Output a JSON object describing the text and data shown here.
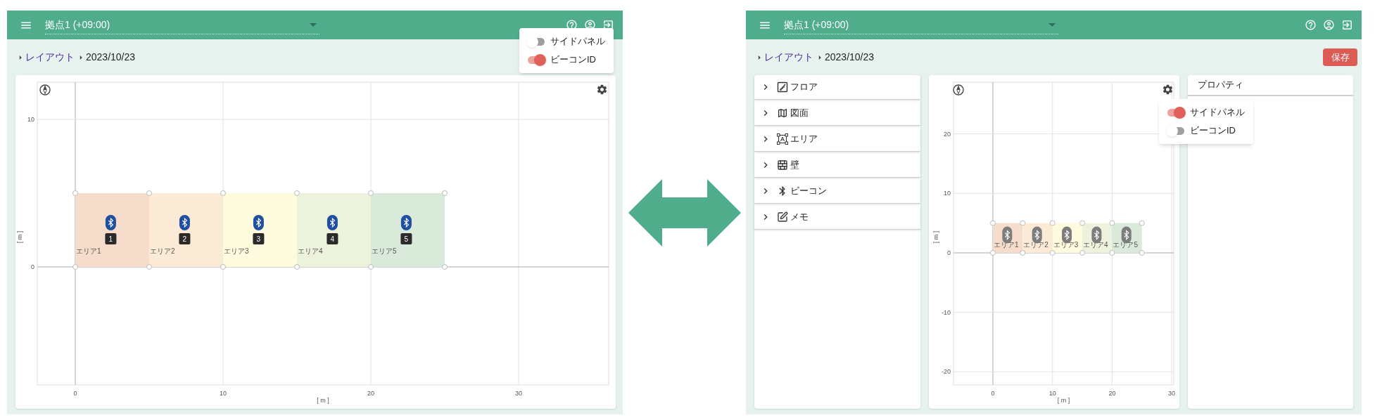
{
  "screens": [
    {
      "header": {
        "location": "拠点1 (+09:00)"
      },
      "breadcrumb": [
        {
          "label": "レイアウト",
          "link": true
        },
        {
          "label": "2023/10/23",
          "link": false
        }
      ],
      "settings_menu": [
        {
          "label": "サイドパネル",
          "on": false
        },
        {
          "label": "ビーコンID",
          "on": true
        }
      ],
      "canvas": {
        "x_ticks": [
          "0",
          "10",
          "20",
          "30"
        ],
        "y_ticks": [
          "10",
          "0"
        ],
        "x_axis_label": "[ m ]",
        "y_axis_label": "[ m ]",
        "areas": [
          {
            "name": "エリア1",
            "color": "#f6dccb",
            "beacon_id": "1"
          },
          {
            "name": "エリア2",
            "color": "#fbead5",
            "beacon_id": "2"
          },
          {
            "name": "エリア3",
            "color": "#fefadd",
            "beacon_id": "3"
          },
          {
            "name": "エリア4",
            "color": "#ecf2dc",
            "beacon_id": "4"
          },
          {
            "name": "エリア5",
            "color": "#d9e9da",
            "beacon_id": "5"
          }
        ]
      }
    },
    {
      "header": {
        "location": "拠点1 (+09:00)"
      },
      "breadcrumb": [
        {
          "label": "レイアウト",
          "link": true
        },
        {
          "label": "2023/10/23",
          "link": false
        }
      ],
      "save_button": {
        "label": "保存"
      },
      "settings_menu": [
        {
          "label": "サイドパネル",
          "on": true
        },
        {
          "label": "ビーコンID",
          "on": false
        }
      ],
      "side_panel": {
        "items": [
          {
            "kind": "floor",
            "label": "フロア",
            "expanded": false
          },
          {
            "kind": "drawing",
            "label": "図面",
            "expanded": false
          },
          {
            "kind": "area",
            "label": "エリア",
            "expanded": false
          },
          {
            "kind": "wall",
            "label": "壁",
            "expanded": false
          },
          {
            "kind": "beacon",
            "label": "ビーコン",
            "expanded": false
          },
          {
            "kind": "memo",
            "label": "メモ",
            "expanded": false
          }
        ]
      },
      "property_panel": {
        "title": "プロパティ"
      },
      "canvas": {
        "x_ticks": [
          "0",
          "10",
          "20",
          "30"
        ],
        "y_ticks": [
          "20",
          "10",
          "0",
          "-10",
          "-20"
        ],
        "x_axis_label": "[ m ]",
        "y_axis_label": "[ m ]",
        "areas": [
          {
            "name": "エリア1",
            "color": "#f6dccb"
          },
          {
            "name": "エリア2",
            "color": "#fbead5"
          },
          {
            "name": "エリア3",
            "color": "#fefadd"
          },
          {
            "name": "エリア4",
            "color": "#ecf2dc"
          },
          {
            "name": "エリア5",
            "color": "#d9e9da"
          }
        ]
      }
    }
  ]
}
